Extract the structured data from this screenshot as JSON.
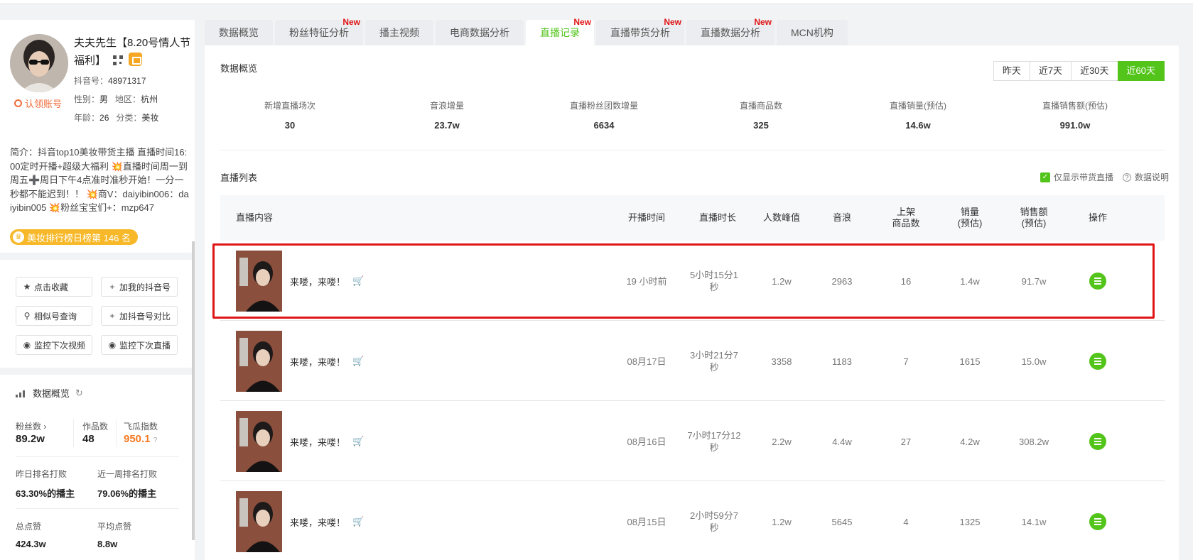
{
  "profile": {
    "name": "夫夫先生【8.20号情人节福利】",
    "claim_label": "认领账号",
    "douyin_id_label": "抖音号：",
    "douyin_id": "48971317",
    "gender_label": "性别：",
    "gender": "男",
    "region_label": "地区：",
    "region": "杭州",
    "age_label": "年龄：",
    "age": "26",
    "category_label": "分类：",
    "category": "美妆",
    "intro": "简介：抖音top10美妆带货主播 直播时间16:00定时开播+超级大福利 💥直播时间周一到周五➕周日下午4点准时准秒开始！一分一秒都不能迟到！！ 💥商V：daiyibin006：daiyibin005 💥粉丝宝宝们+：mzp647",
    "rank_badge": "美妆排行榜日榜第 146 名",
    "icons": [
      "qr-code-icon",
      "shop-icon",
      "crown-icon"
    ]
  },
  "actions": {
    "favorite": "点击收藏",
    "add_mine": "加我的抖音号",
    "similar": "相似号查询",
    "compare": "加抖音号对比",
    "monitor_video": "监控下次视频",
    "monitor_live": "监控下次直播"
  },
  "overview_side": {
    "title": "数据概览",
    "fans_label": "粉丝数",
    "fans": "89.2w",
    "works_label": "作品数",
    "works": "48",
    "index_label": "飞瓜指数",
    "index": "950.1",
    "yday_rank_label": "昨日排名打败",
    "yday_rank": "63.30%的播主",
    "week_rank_label": "近一周排名打败",
    "week_rank": "79.06%的播主",
    "likes_label": "总点赞",
    "likes": "424.3w",
    "avg_likes_label": "平均点赞",
    "avg_likes": "8.8w"
  },
  "tabs": [
    {
      "label": "数据概览",
      "new": ""
    },
    {
      "label": "粉丝特征分析",
      "new": "New"
    },
    {
      "label": "播主视频",
      "new": ""
    },
    {
      "label": "电商数据分析",
      "new": ""
    },
    {
      "label": "直播记录",
      "new": "New"
    },
    {
      "label": "直播带货分析",
      "new": "New"
    },
    {
      "label": "直播数据分析",
      "new": "New"
    },
    {
      "label": "MCN机构",
      "new": ""
    }
  ],
  "main": {
    "overview_title": "数据概览",
    "ranges": [
      "昨天",
      "近7天",
      "近30天",
      "近60天"
    ],
    "active_range": "近60天",
    "kpis": [
      {
        "label": "新增直播场次",
        "value": "30"
      },
      {
        "label": "音浪增量",
        "value": "23.7w"
      },
      {
        "label": "直播粉丝团数增量",
        "value": "6634"
      },
      {
        "label": "直播商品数",
        "value": "325"
      },
      {
        "label": "直播销量(预估)",
        "value": "14.6w"
      },
      {
        "label": "直播销售额(预估)",
        "value": "991.0w"
      }
    ],
    "list_title": "直播列表",
    "only_sales_label": "仅显示带货直播",
    "explain_label": "数据说明",
    "columns": [
      "直播内容",
      "开播时间",
      "直播时长",
      "人数峰值",
      "音浪",
      "上架\n商品数",
      "销量\n(预估)",
      "销售额\n(预估)",
      "操作"
    ],
    "rows": [
      {
        "title": "来喽，来喽！",
        "start": "19 小时前",
        "duration": "5小时15分1秒",
        "peak": "1.2w",
        "yinlang": "2963",
        "goods": "16",
        "sales": "1.4w",
        "revenue": "91.7w"
      },
      {
        "title": "来喽，来喽！",
        "start": "08月17日",
        "duration": "3小时21分7秒",
        "peak": "3358",
        "yinlang": "1183",
        "goods": "7",
        "sales": "1615",
        "revenue": "15.0w"
      },
      {
        "title": "来喽，来喽！",
        "start": "08月16日",
        "duration": "7小时17分12秒",
        "peak": "2.2w",
        "yinlang": "4.4w",
        "goods": "27",
        "sales": "4.2w",
        "revenue": "308.2w"
      },
      {
        "title": "来喽，来喽！",
        "start": "08月15日",
        "duration": "2小时59分7秒",
        "peak": "1.2w",
        "yinlang": "5645",
        "goods": "4",
        "sales": "1325",
        "revenue": "14.1w"
      }
    ]
  },
  "colors": {
    "accent": "#52c41a",
    "new_badge": "#e01515",
    "orange": "#f57a22",
    "highlight": "#e01515"
  }
}
